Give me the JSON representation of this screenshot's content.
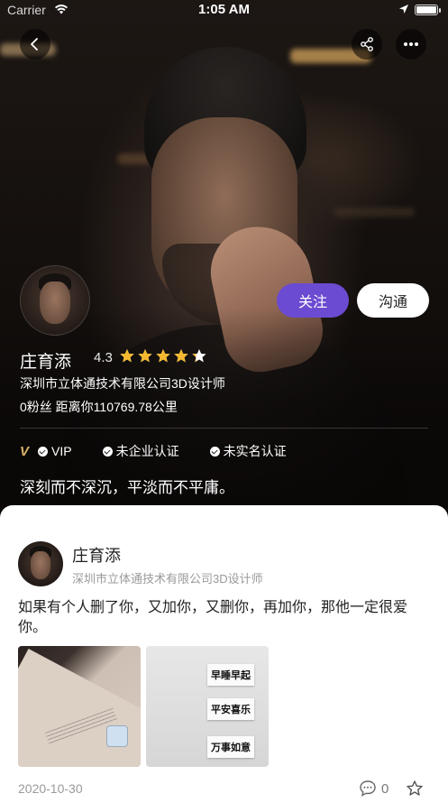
{
  "status_bar": {
    "carrier": "Carrier",
    "time": "1:05 AM",
    "battery_level": 1.0
  },
  "nav": {
    "back_icon": "chevron-left-icon",
    "share_icon": "share-icon",
    "more_icon": "more-horizontal-icon"
  },
  "profile": {
    "name": "庄育添",
    "rating": "4.3",
    "rating_value": 4.3,
    "rating_max": 5,
    "company_title": "深圳市立体通技术有限公司3D设计师",
    "stats": "0粉丝 距离你110769.78公里",
    "follow_label": "关注",
    "chat_label": "沟通",
    "badges": {
      "vip_mark": "V",
      "vip": "VIP",
      "enterprise": "未企业认证",
      "realname": "未实名认证"
    },
    "motto": "深刻而不深沉，平淡而不平庸。"
  },
  "post": {
    "author": "庄育添",
    "company_title": "深圳市立体通技术有限公司3D设计师",
    "text": "如果有个人删了你，又加你，又删你，再加你，那他一定很爱你。",
    "notes": [
      "早睡早起",
      "平安喜乐",
      "万事如意"
    ],
    "date": "2020-10-30",
    "comment_count": "0"
  },
  "colors": {
    "accent": "#6b4bd1",
    "star": "#f5b82e",
    "vip": "#d8b26a"
  }
}
